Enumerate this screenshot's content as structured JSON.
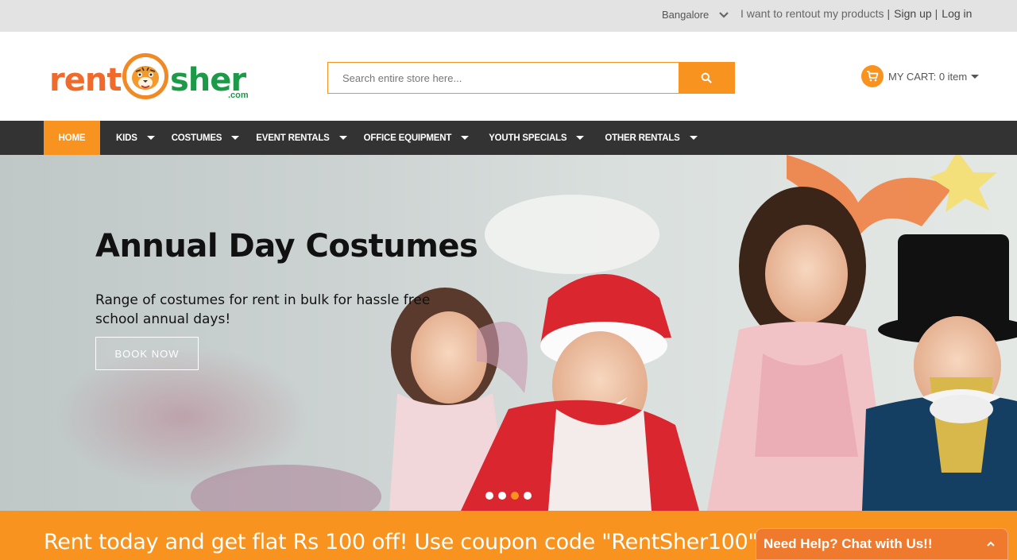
{
  "topbar": {
    "city": "Bangalore",
    "rentout_link": "I want to rentout my products",
    "signup_link": "Sign up",
    "login_link": "Log in"
  },
  "header": {
    "logo_rent": "rent",
    "logo_sher": "sher",
    "logo_com": ".com",
    "search_placeholder": "Search entire store here...",
    "cart_label": "MY CART: 0 item"
  },
  "nav": {
    "items": [
      {
        "label": "HOME",
        "has_dropdown": false
      },
      {
        "label": "KIDS",
        "has_dropdown": true
      },
      {
        "label": "COSTUMES",
        "has_dropdown": true
      },
      {
        "label": "EVENT RENTALS",
        "has_dropdown": true
      },
      {
        "label": "OFFICE EQUIPMENT",
        "has_dropdown": true
      },
      {
        "label": "YOUTH SPECIALS",
        "has_dropdown": true
      },
      {
        "label": "OTHER RENTALS",
        "has_dropdown": true
      }
    ]
  },
  "hero": {
    "title": "Annual Day Costumes",
    "description": "Range of costumes for rent in bulk for hassle free school annual days!",
    "button_label": "BOOK NOW",
    "slide_count": 4,
    "active_slide": 3
  },
  "promo": {
    "text": "Rent today and get flat Rs 100 off! Use coupon code \"RentSher100\""
  },
  "chat": {
    "label": "Need Help? Chat with Us!!"
  },
  "colors": {
    "accent": "#f7931e",
    "nav_bg": "#333334",
    "logo_orange": "#f06a2c",
    "logo_green": "#1d9a48",
    "chat_bg": "#ef7a2e"
  },
  "icons": {
    "city_dropdown": "chevron-down-icon",
    "search": "search-icon",
    "cart": "cart-icon",
    "chat_toggle": "chevron-up-icon"
  }
}
